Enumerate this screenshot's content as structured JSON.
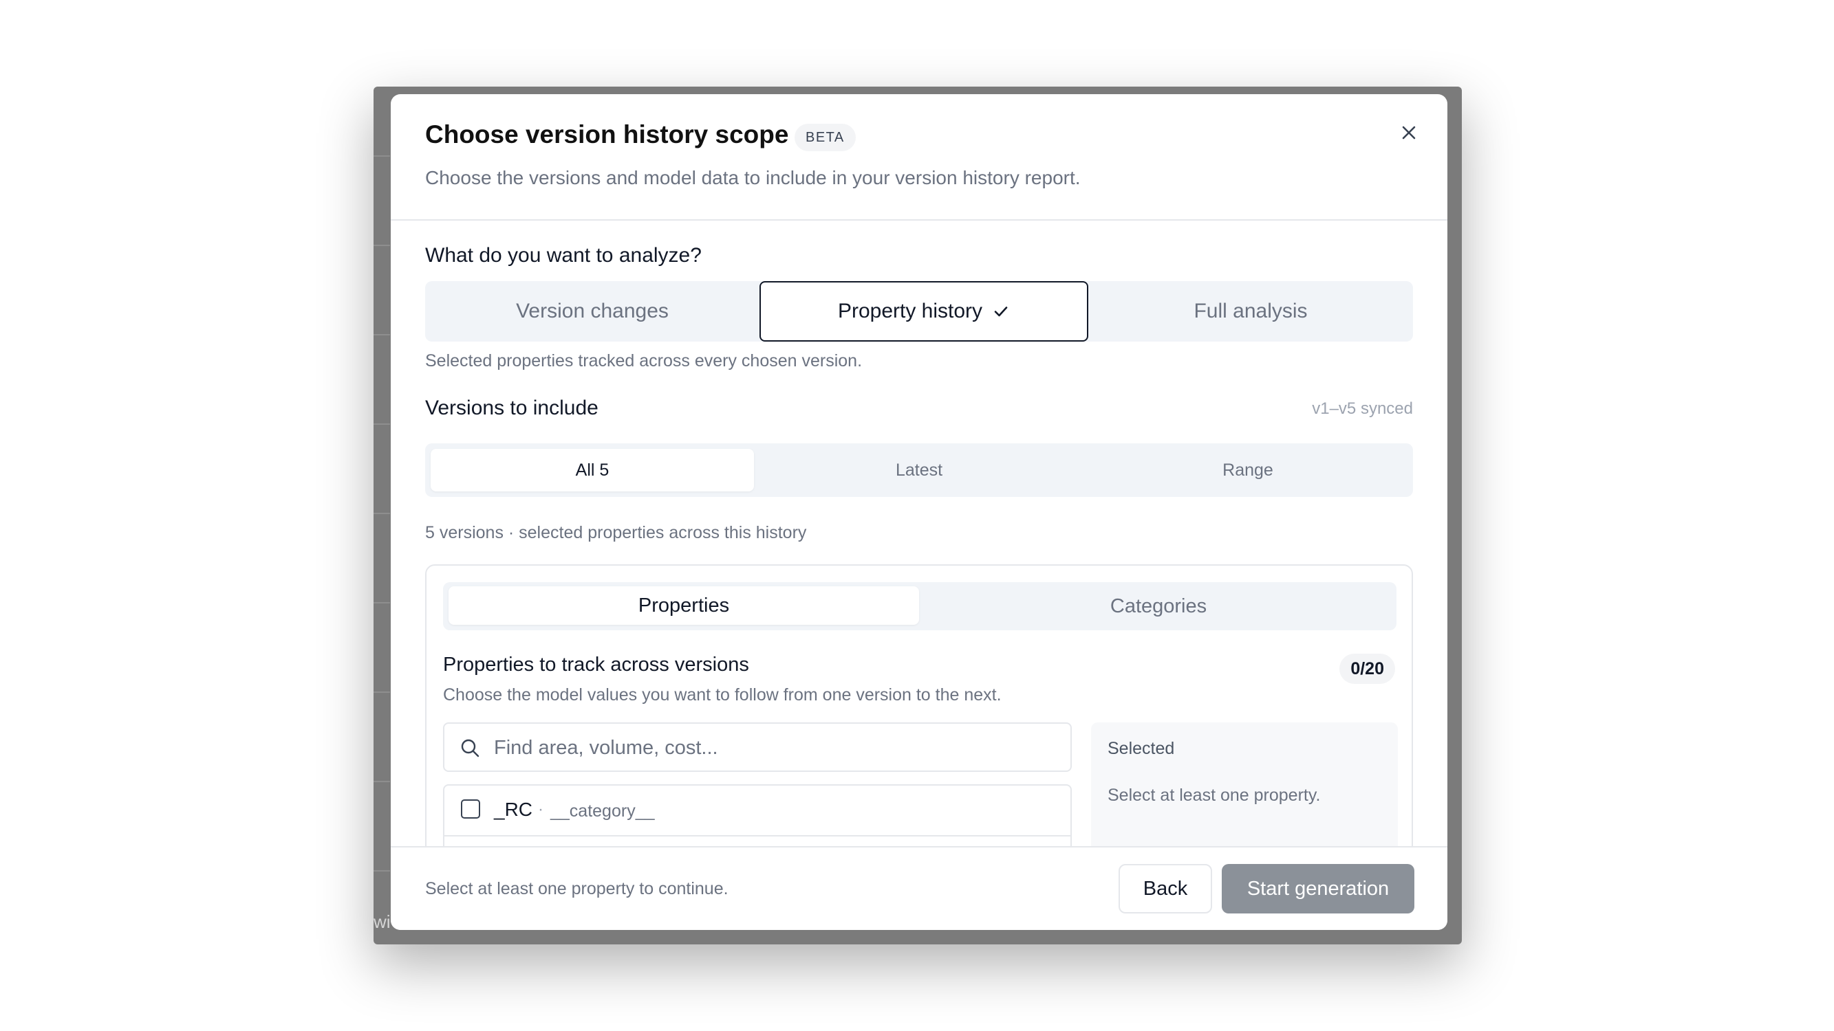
{
  "background": {
    "clipped_text": "wi"
  },
  "dialog": {
    "title": "Choose version history scope",
    "badge": "BETA",
    "subtitle": "Choose the versions and model data to include in your version history report.",
    "close_icon": "close-icon"
  },
  "analyze": {
    "label": "What do you want to analyze?",
    "options": [
      "Version changes",
      "Property history",
      "Full analysis"
    ],
    "selected": "Property history",
    "selected_icon": "check-icon",
    "description": "Selected properties tracked across every chosen version."
  },
  "versions": {
    "label": "Versions to include",
    "sync_status": "v1–v5 synced",
    "options": [
      "All 5",
      "Latest",
      "Range"
    ],
    "selected": "All 5",
    "description": "5 versions · selected properties across this history"
  },
  "panel": {
    "tabs": [
      "Properties",
      "Categories"
    ],
    "active_tab": "Properties",
    "title": "Properties to track across versions",
    "count": "0/20",
    "description": "Choose the model values you want to follow from one version to the next.",
    "search": {
      "placeholder": "Find area, volume, cost...",
      "value": "",
      "icon": "search-icon"
    },
    "items": [
      {
        "name": "_RC",
        "separator": "·",
        "category": "__category__",
        "checked": false
      }
    ],
    "selected_box": {
      "title": "Selected",
      "empty_text": "Select at least one property."
    }
  },
  "footer": {
    "message": "Select at least one property to continue.",
    "back_label": "Back",
    "start_label": "Start generation"
  },
  "colors": {
    "accent": "#111827",
    "segment_bg": "#f1f4f8",
    "disabled_button": "#8b9199",
    "backdrop": "#7b7b7b"
  }
}
